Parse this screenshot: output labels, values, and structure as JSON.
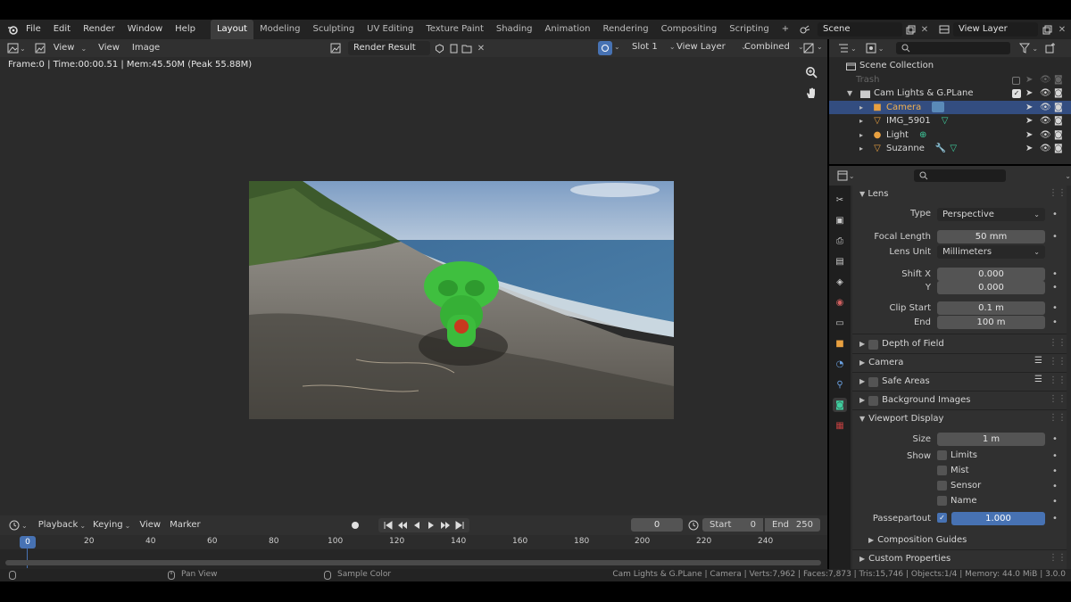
{
  "menus": [
    "File",
    "Edit",
    "Render",
    "Window",
    "Help"
  ],
  "workspaces": [
    "Layout",
    "Modeling",
    "Sculpting",
    "UV Editing",
    "Texture Paint",
    "Shading",
    "Animation",
    "Rendering",
    "Compositing",
    "Scripting"
  ],
  "active_workspace": "Layout",
  "add_workspace": "+",
  "scene_name": "Scene",
  "view_layer_name": "View Layer",
  "image_editor": {
    "view_menu": "View",
    "view": "View",
    "image": "Image",
    "image_name": "Render Result",
    "slot": "Slot 1",
    "layer": "View Layer",
    "pass": "Combined",
    "info": "Frame:0 | Time:00:00.51 | Mem:45.50M (Peak 55.88M)"
  },
  "timeline": {
    "menus": [
      "Playback",
      "Keying",
      "View",
      "Marker"
    ],
    "current_frame": "0",
    "start_label": "Start",
    "start": "0",
    "end_label": "End",
    "end": "250",
    "ticks": [
      "0",
      "20",
      "40",
      "60",
      "80",
      "100",
      "120",
      "140",
      "160",
      "180",
      "200",
      "220",
      "240"
    ]
  },
  "status": {
    "pan": "Pan View",
    "sample": "Sample Color",
    "stats": "Cam Lights & G.PLane | Camera | Verts:7,962 | Faces:7,873 | Tris:15,746 | Objects:1/4 | Memory: 44.0 MiB | 3.0.0"
  },
  "outliner": {
    "root": "Scene Collection",
    "items": [
      {
        "name": "Trash",
        "level": 1
      },
      {
        "name": "Cam Lights & G.PLane",
        "level": 1
      },
      {
        "name": "Camera",
        "level": 2
      },
      {
        "name": "IMG_5901",
        "level": 2
      },
      {
        "name": "Light",
        "level": 2
      },
      {
        "name": "Suzanne",
        "level": 2
      }
    ]
  },
  "properties": {
    "lens_section": "Lens",
    "type_label": "Type",
    "type_value": "Perspective",
    "focal_label": "Focal Length",
    "focal_value": "50 mm",
    "lens_unit_label": "Lens Unit",
    "lens_unit_value": "Millimeters",
    "shiftx_label": "Shift X",
    "shiftx_value": "0.000",
    "shifty_label": "Y",
    "shifty_value": "0.000",
    "clipstart_label": "Clip Start",
    "clipstart_value": "0.1 m",
    "clipend_label": "End",
    "clipend_value": "100 m",
    "dof": "Depth of Field",
    "camera": "Camera",
    "safe_areas": "Safe Areas",
    "bg_images": "Background Images",
    "viewport_display": "Viewport Display",
    "size_label": "Size",
    "size_value": "1 m",
    "show_label": "Show",
    "show_items": [
      "Limits",
      "Mist",
      "Sensor",
      "Name"
    ],
    "passepartout_label": "Passepartout",
    "passepartout_value": "1.000",
    "comp_guides": "Composition Guides",
    "custom_props": "Custom Properties"
  },
  "colors": {
    "accent": "#4772b3",
    "selected_row": "#334d80",
    "suzanne": "#3fbf3f"
  }
}
